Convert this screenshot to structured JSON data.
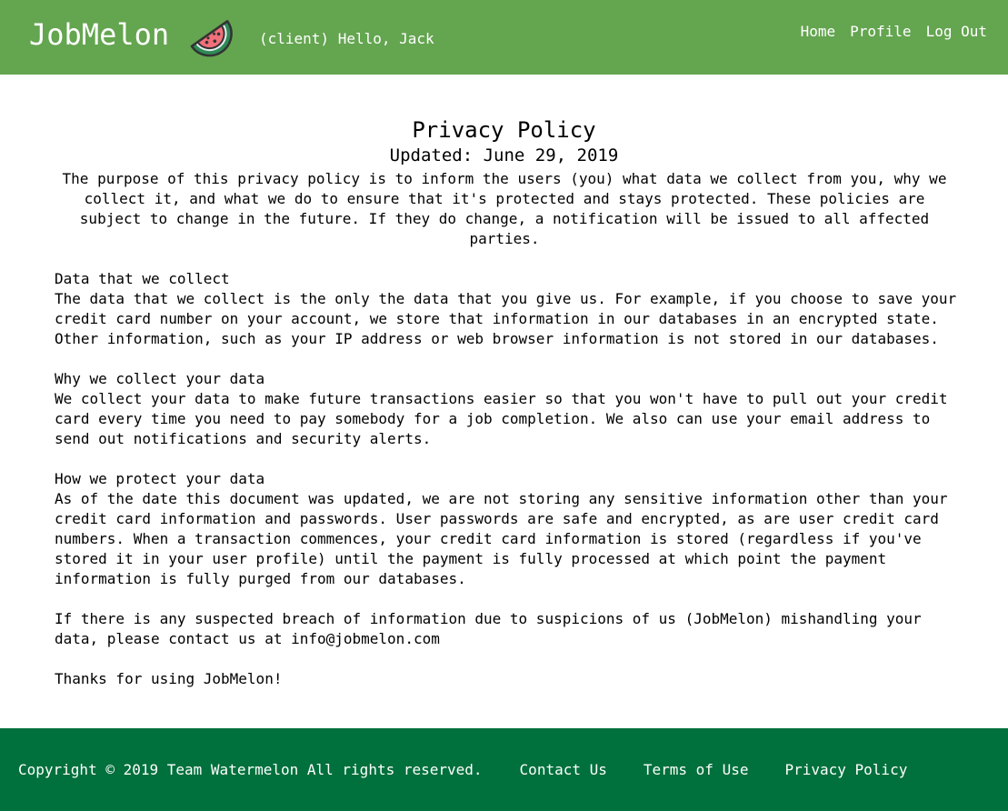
{
  "header": {
    "brand": "JobMelon",
    "greeting": "(client) Hello, Jack",
    "nav": {
      "home": "Home",
      "profile": "Profile",
      "logout": "Log Out"
    },
    "logo_icon": "watermelon-slice-icon",
    "colors": {
      "bar": "#64a550"
    }
  },
  "main": {
    "title": "Privacy Policy",
    "updated": "Updated: June 29, 2019",
    "intro": "The purpose of this privacy policy is to inform the users (you) what data we collect from you, why we collect it, and what we do to ensure that it's protected and stays protected. These policies are subject to change in the future. If they do change, a notification will be issued to all affected parties.",
    "sections": [
      {
        "heading": "Data that we collect",
        "text": "The data that we collect is the only the data that you give us. For example, if you choose to save your credit card number on your account, we store that information in our databases in an encrypted state. Other information, such as your IP address or web browser information is not stored in our databases."
      },
      {
        "heading": "Why we collect your data",
        "text": "We collect your data to make future transactions easier so that you won't have to pull out your credit card every time you need to pay somebody for a job completion. We also can use your email address to send out notifications and security alerts."
      },
      {
        "heading": "How we protect your data",
        "text": "As of the date this document was updated, we are not storing any sensitive information other than your credit card information and passwords. User passwords are safe and encrypted, as are user credit card numbers. When a transaction commences, your credit card information is stored (regardless if you've stored it in your user profile) until the payment is fully processed at which point the payment information is fully purged from our databases."
      }
    ],
    "breach_notice": "If there is any suspected breach of information due to suspicions of us (JobMelon) mishandling your data, please contact us at info@jobmelon.com",
    "thanks": "Thanks for using JobMelon!"
  },
  "footer": {
    "copyright": "Copyright © 2019 Team Watermelon All rights reserved.",
    "contact": "Contact Us",
    "terms": "Terms of Use",
    "privacy": "Privacy Policy",
    "colors": {
      "bar": "#00703c"
    }
  }
}
